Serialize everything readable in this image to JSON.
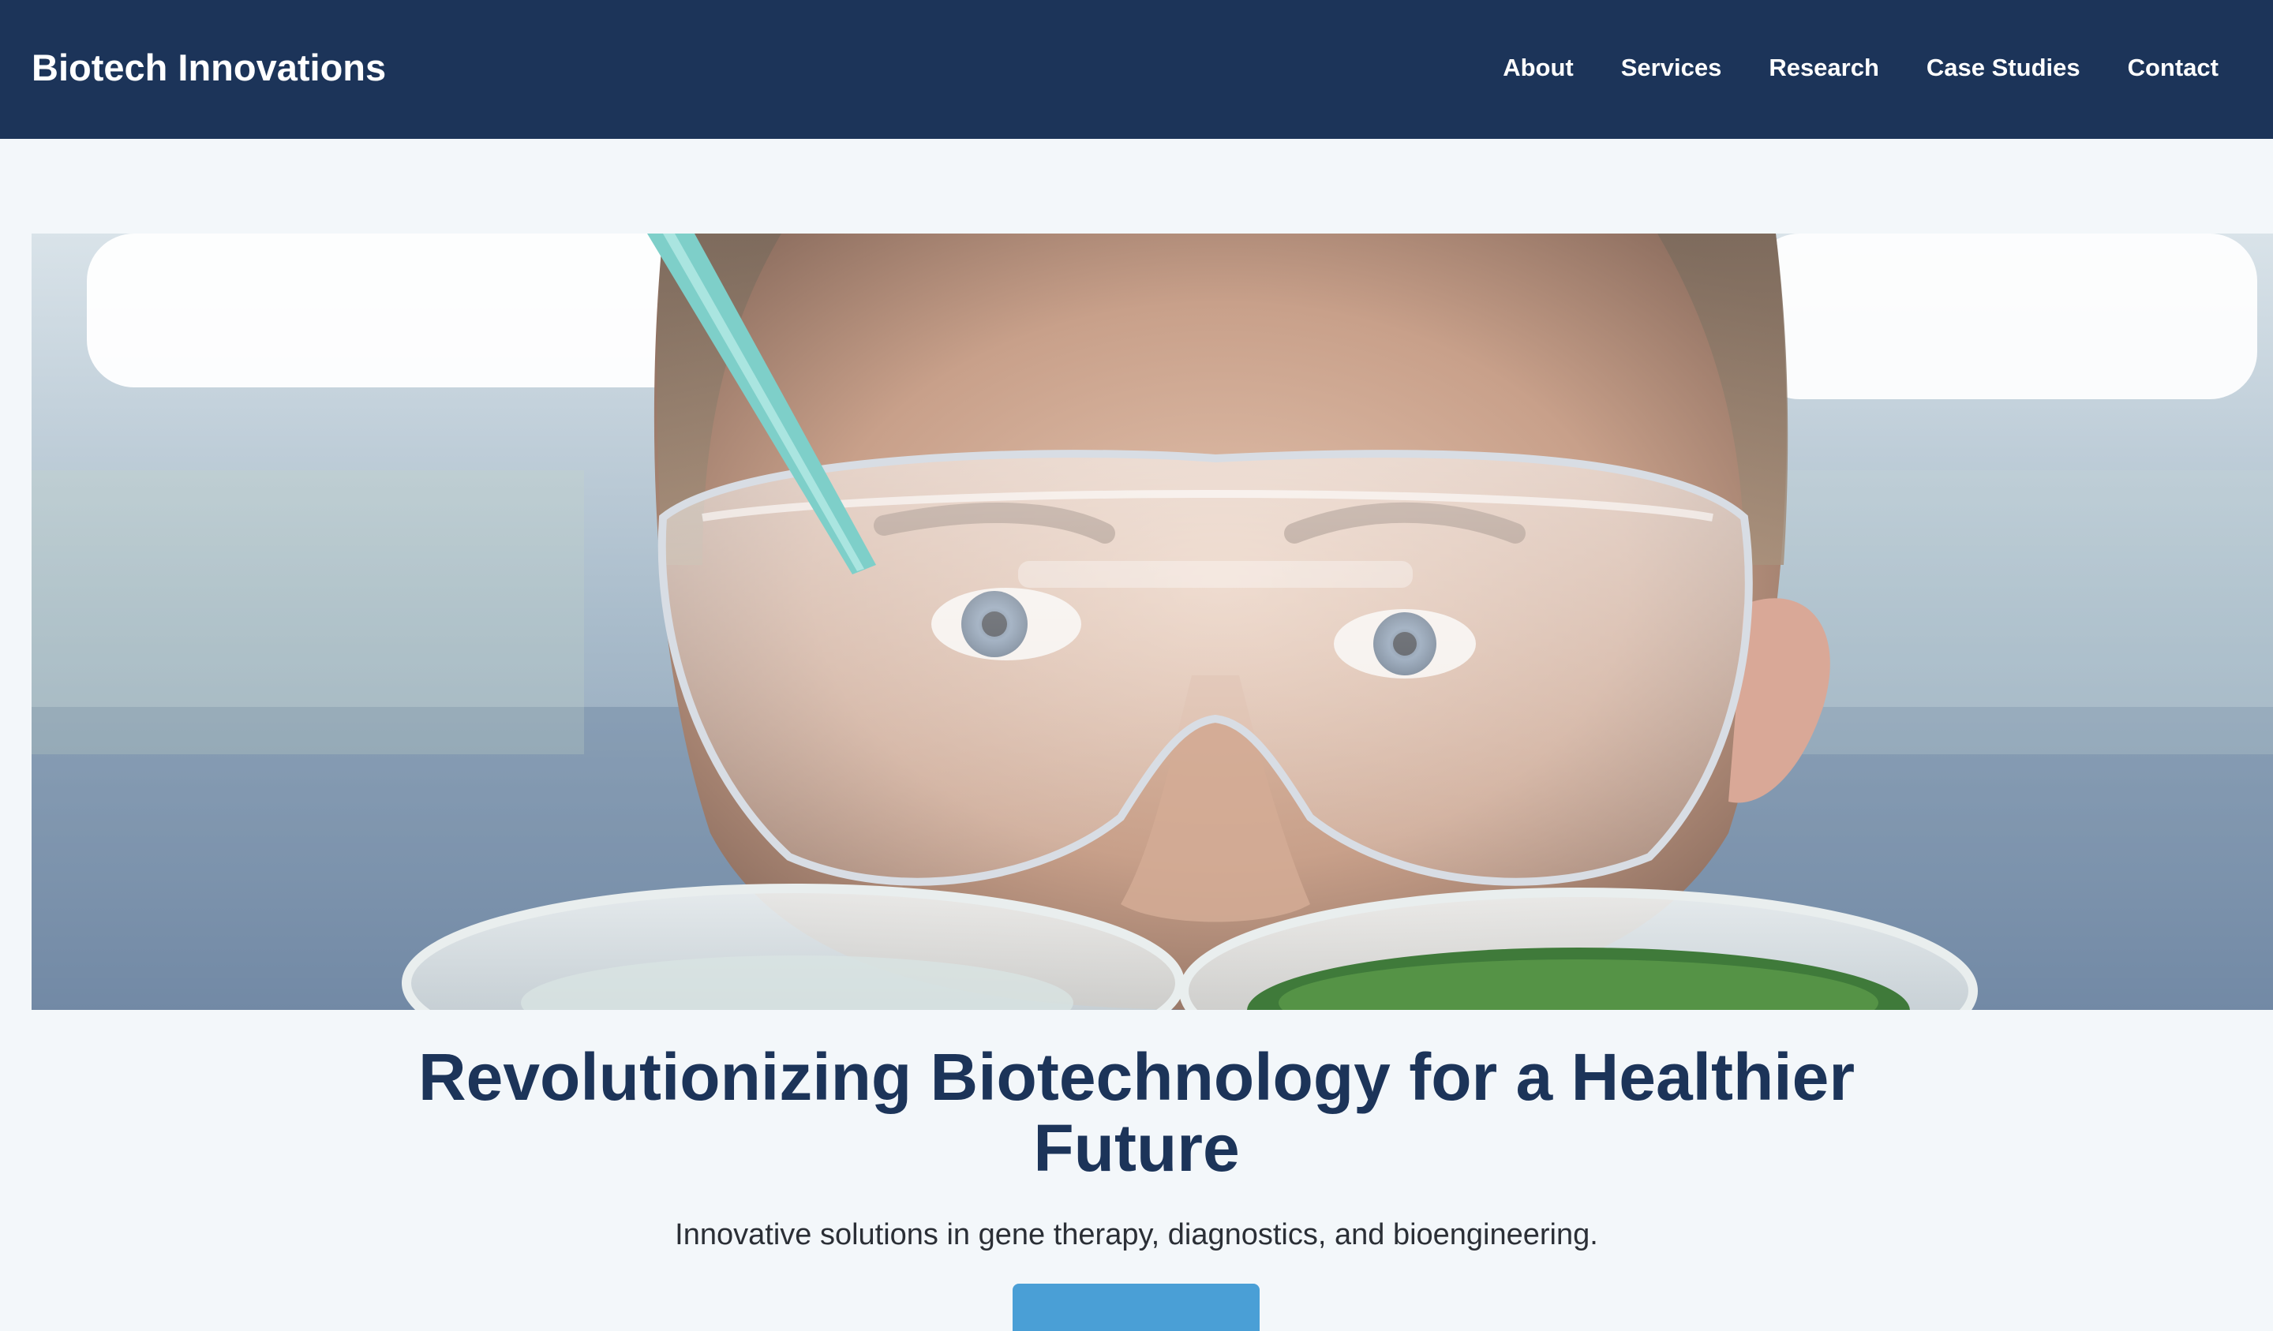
{
  "header": {
    "brand": "Biotech Innovations",
    "nav": [
      "About",
      "Services",
      "Research",
      "Case Studies",
      "Contact"
    ]
  },
  "hero": {
    "image_alt": "Scientist in clear safety goggles examining petri dishes while a pipette tip approaches",
    "title": "Revolutionizing Biotechnology for a Healthier Future",
    "subtitle": "Innovative solutions in gene therapy, diagnostics, and bioengineering.",
    "cta_label": ""
  },
  "colors": {
    "header_bg": "#1c3459",
    "page_bg": "#f3f7fa",
    "title": "#1c3459",
    "accent": "#4a9fd6"
  }
}
